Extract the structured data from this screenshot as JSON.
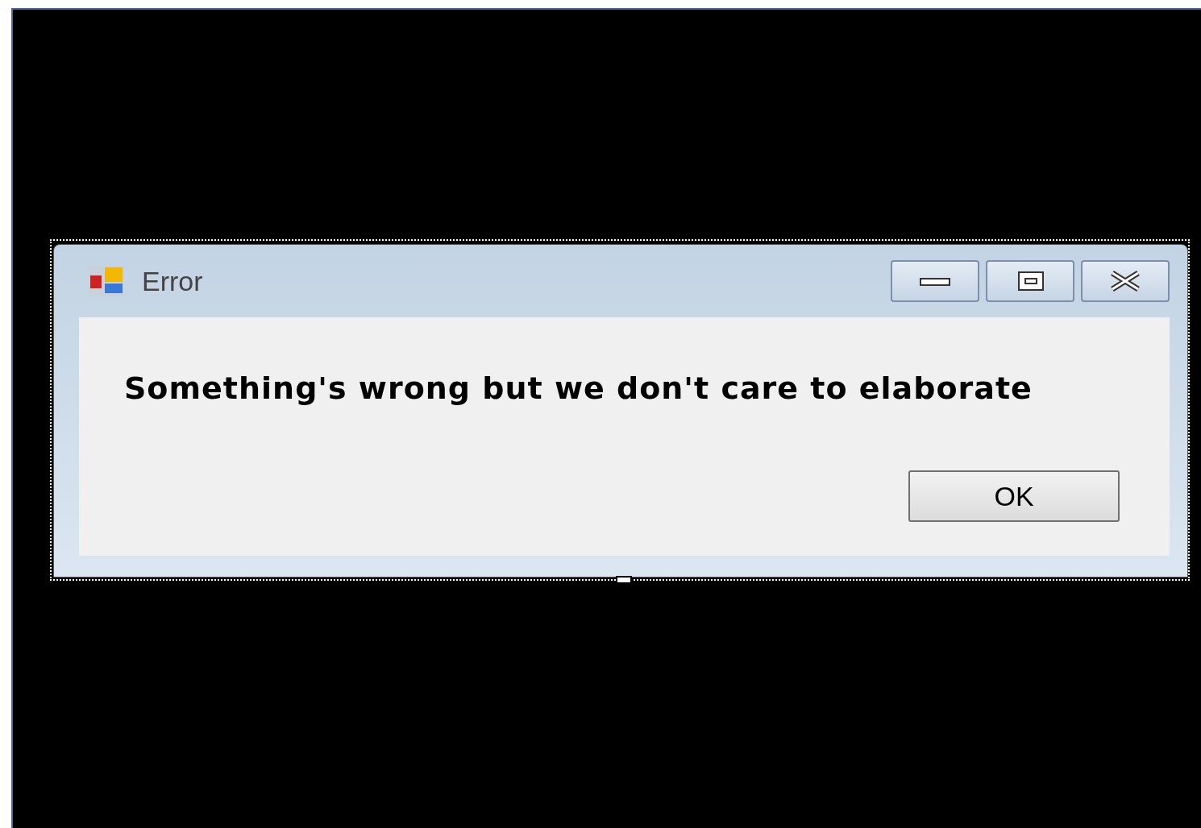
{
  "window": {
    "title": "Error"
  },
  "title_buttons": [
    {
      "kind": "minimize"
    },
    {
      "kind": "maximize"
    },
    {
      "kind": "close"
    }
  ],
  "message": "Something's wrong but we don't care to elaborate",
  "buttons": [
    "OK"
  ]
}
